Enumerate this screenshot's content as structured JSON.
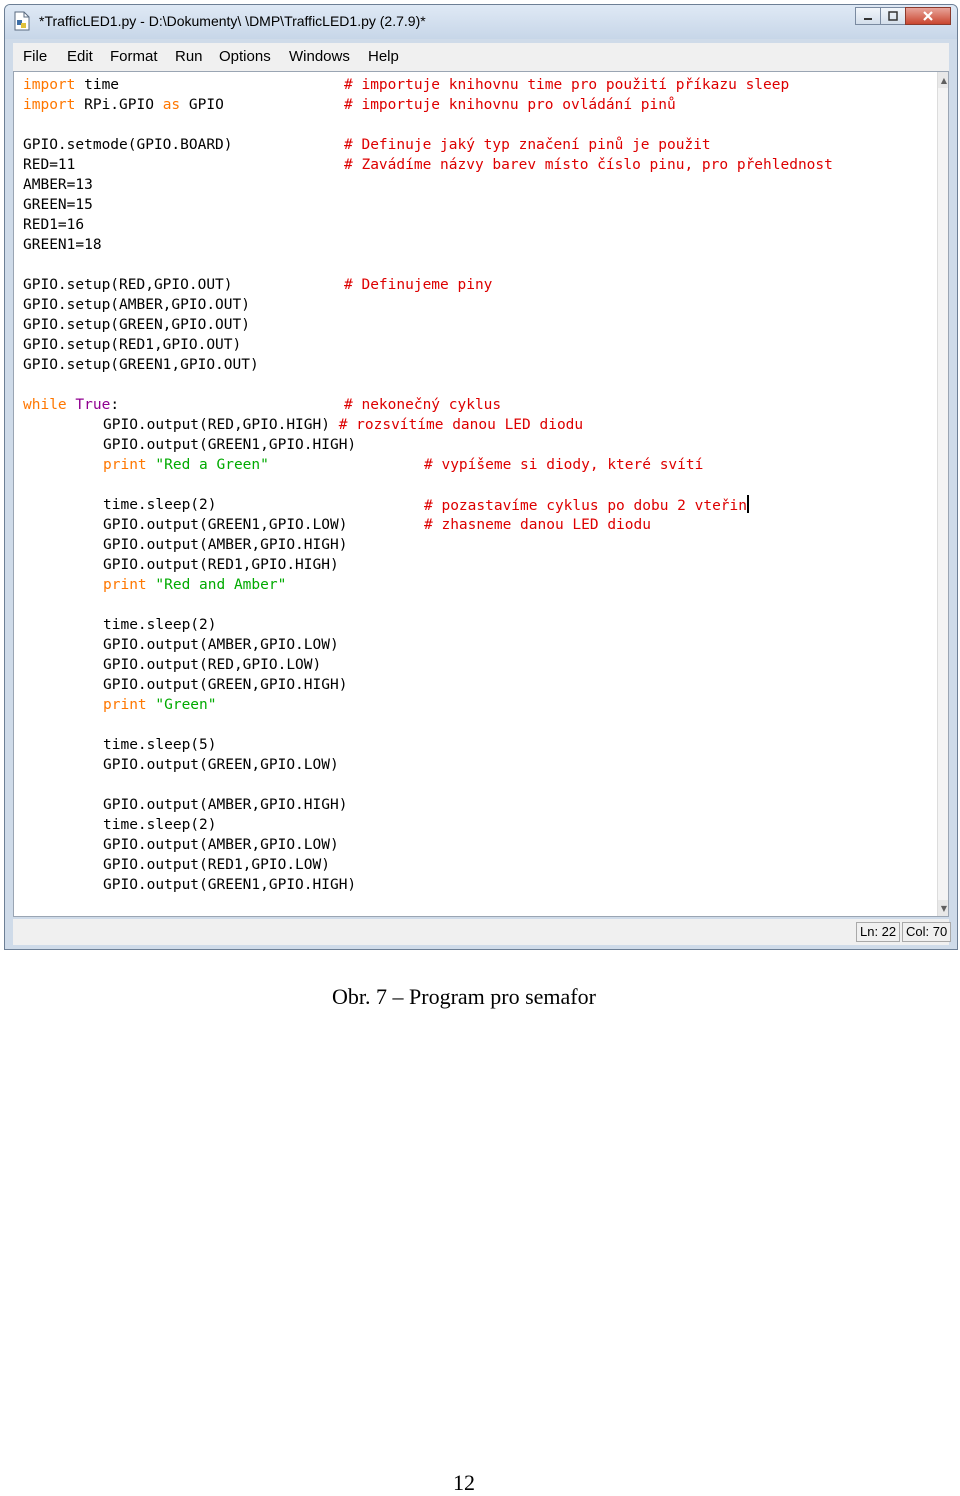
{
  "window": {
    "title": "*TrafficLED1.py - D:\\Dokumenty\\ \\DMP\\TrafficLED1.py (2.7.9)*"
  },
  "menu": [
    "File",
    "Edit",
    "Format",
    "Run",
    "Options",
    "Windows",
    "Help"
  ],
  "code": {
    "l1": [
      "import",
      " time",
      "# importuje knihovnu time pro použití příkazu sleep"
    ],
    "l2": [
      "import",
      " RPi.GPIO ",
      "as",
      " GPIO",
      "# importuje knihovnu pro ovládání pinů"
    ],
    "l3": [
      "GPIO.setmode(GPIO.BOARD)",
      "# Definuje jaký typ značení pinů je použit"
    ],
    "l4": [
      "RED=11",
      "# Zavádíme názvy barev místo číslo pinu, pro přehlednost"
    ],
    "l5": "AMBER=13",
    "l6": "GREEN=15",
    "l7": "RED1=16",
    "l8": "GREEN1=18",
    "l9": [
      "GPIO.setup(RED,GPIO.OUT)",
      "# Definujeme piny"
    ],
    "l10": "GPIO.setup(AMBER,GPIO.OUT)",
    "l11": "GPIO.setup(GREEN,GPIO.OUT)",
    "l12": "GPIO.setup(RED1,GPIO.OUT)",
    "l13": "GPIO.setup(GREEN1,GPIO.OUT)",
    "l14": [
      "while",
      " True",
      ":",
      "# nekonečný cyklus"
    ],
    "l15": [
      "GPIO.output(RED,GPIO.HIGH) ",
      "# rozsvítíme danou LED diodu"
    ],
    "l16": "GPIO.output(GREEN1,GPIO.HIGH)",
    "l17": [
      "print",
      " \"Red a Green\"",
      "# vypíšeme si diody, které svítí"
    ],
    "l18": [
      "time.sleep(2)",
      "# pozastavíme cyklus po dobu 2 vteřin"
    ],
    "l19": [
      "GPIO.output(GREEN1,GPIO.LOW)",
      "# zhasneme danou LED diodu"
    ],
    "l20": "GPIO.output(AMBER,GPIO.HIGH)",
    "l21": "GPIO.output(RED1,GPIO.HIGH)",
    "l22": [
      "print",
      " \"Red and Amber\""
    ],
    "l23": "time.sleep(2)",
    "l24": "GPIO.output(AMBER,GPIO.LOW)",
    "l25": "GPIO.output(RED,GPIO.LOW)",
    "l26": "GPIO.output(GREEN,GPIO.HIGH)",
    "l27": [
      "print",
      " \"Green\""
    ],
    "l28": "time.sleep(5)",
    "l29": "GPIO.output(GREEN,GPIO.LOW)",
    "l30": "GPIO.output(AMBER,GPIO.HIGH)",
    "l31": "time.sleep(2)",
    "l32": "GPIO.output(AMBER,GPIO.LOW)",
    "l33": "GPIO.output(RED1,GPIO.LOW)",
    "l34": "GPIO.output(GREEN1,GPIO.HIGH)"
  },
  "status": {
    "line": "Ln: 22",
    "col": "Col: 70"
  },
  "caption": "Obr. 7 – Program pro semafor",
  "page_number": "12",
  "colors": {
    "keyword": "#ff7700",
    "builtin": "#900090",
    "comment": "#dd0000",
    "string": "#00aa00"
  }
}
